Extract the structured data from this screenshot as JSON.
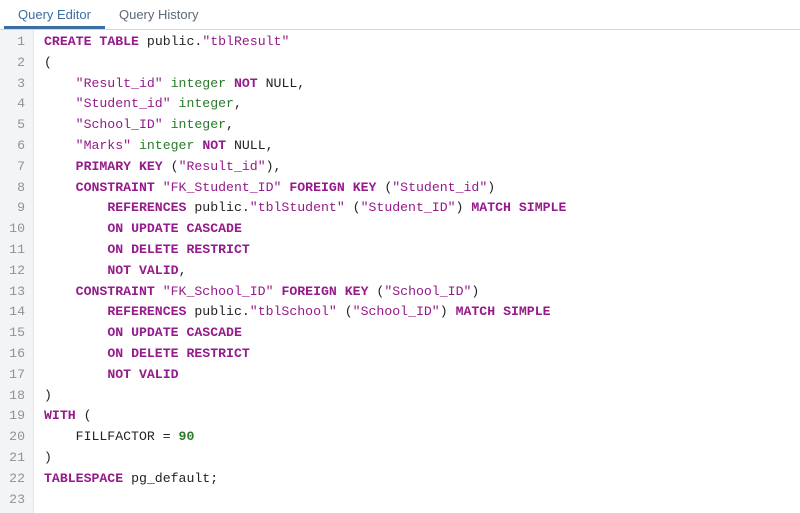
{
  "tabs": {
    "editor": "Query Editor",
    "history": "Query History",
    "active": "editor"
  },
  "code_lines": [
    [
      [
        "kw",
        "CREATE"
      ],
      [
        "pn",
        " "
      ],
      [
        "kw",
        "TABLE"
      ],
      [
        "pn",
        " "
      ],
      [
        "id",
        "public"
      ],
      [
        "pn",
        "."
      ],
      [
        "str",
        "\"tblResult\""
      ]
    ],
    [
      [
        "pn",
        "("
      ]
    ],
    [
      [
        "pn",
        "    "
      ],
      [
        "str",
        "\"Result_id\""
      ],
      [
        "pn",
        " "
      ],
      [
        "dt",
        "integer"
      ],
      [
        "pn",
        " "
      ],
      [
        "kw",
        "NOT"
      ],
      [
        "pn",
        " "
      ],
      [
        "null",
        "NULL"
      ],
      [
        "pn",
        ","
      ]
    ],
    [
      [
        "pn",
        "    "
      ],
      [
        "str",
        "\"Student_id\""
      ],
      [
        "pn",
        " "
      ],
      [
        "dt",
        "integer"
      ],
      [
        "pn",
        ","
      ]
    ],
    [
      [
        "pn",
        "    "
      ],
      [
        "str",
        "\"School_ID\""
      ],
      [
        "pn",
        " "
      ],
      [
        "dt",
        "integer"
      ],
      [
        "pn",
        ","
      ]
    ],
    [
      [
        "pn",
        "    "
      ],
      [
        "str",
        "\"Marks\""
      ],
      [
        "pn",
        " "
      ],
      [
        "dt",
        "integer"
      ],
      [
        "pn",
        " "
      ],
      [
        "kw",
        "NOT"
      ],
      [
        "pn",
        " "
      ],
      [
        "null",
        "NULL"
      ],
      [
        "pn",
        ","
      ]
    ],
    [
      [
        "pn",
        "    "
      ],
      [
        "kw",
        "PRIMARY"
      ],
      [
        "pn",
        " "
      ],
      [
        "kw",
        "KEY"
      ],
      [
        "pn",
        " ("
      ],
      [
        "str",
        "\"Result_id\""
      ],
      [
        "pn",
        "),"
      ]
    ],
    [
      [
        "pn",
        "    "
      ],
      [
        "kw",
        "CONSTRAINT"
      ],
      [
        "pn",
        " "
      ],
      [
        "str",
        "\"FK_Student_ID\""
      ],
      [
        "pn",
        " "
      ],
      [
        "kw",
        "FOREIGN"
      ],
      [
        "pn",
        " "
      ],
      [
        "kw",
        "KEY"
      ],
      [
        "pn",
        " ("
      ],
      [
        "str",
        "\"Student_id\""
      ],
      [
        "pn",
        ")"
      ]
    ],
    [
      [
        "pn",
        "        "
      ],
      [
        "kw",
        "REFERENCES"
      ],
      [
        "pn",
        " "
      ],
      [
        "id",
        "public"
      ],
      [
        "pn",
        "."
      ],
      [
        "str",
        "\"tblStudent\""
      ],
      [
        "pn",
        " ("
      ],
      [
        "str",
        "\"Student_ID\""
      ],
      [
        "pn",
        ") "
      ],
      [
        "kw",
        "MATCH"
      ],
      [
        "pn",
        " "
      ],
      [
        "kw2",
        "SIMPLE"
      ]
    ],
    [
      [
        "pn",
        "        "
      ],
      [
        "kw",
        "ON"
      ],
      [
        "pn",
        " "
      ],
      [
        "kw2",
        "UPDATE"
      ],
      [
        "pn",
        " "
      ],
      [
        "kw2",
        "CASCADE"
      ]
    ],
    [
      [
        "pn",
        "        "
      ],
      [
        "kw",
        "ON"
      ],
      [
        "pn",
        " "
      ],
      [
        "kw2",
        "DELETE"
      ],
      [
        "pn",
        " "
      ],
      [
        "kw2",
        "RESTRICT"
      ]
    ],
    [
      [
        "pn",
        "        "
      ],
      [
        "kw",
        "NOT"
      ],
      [
        "pn",
        " "
      ],
      [
        "kw2",
        "VALID"
      ],
      [
        "pn",
        ","
      ]
    ],
    [
      [
        "pn",
        "    "
      ],
      [
        "kw",
        "CONSTRAINT"
      ],
      [
        "pn",
        " "
      ],
      [
        "str",
        "\"FK_School_ID\""
      ],
      [
        "pn",
        " "
      ],
      [
        "kw",
        "FOREIGN"
      ],
      [
        "pn",
        " "
      ],
      [
        "kw",
        "KEY"
      ],
      [
        "pn",
        " ("
      ],
      [
        "str",
        "\"School_ID\""
      ],
      [
        "pn",
        ")"
      ]
    ],
    [
      [
        "pn",
        "        "
      ],
      [
        "kw",
        "REFERENCES"
      ],
      [
        "pn",
        " "
      ],
      [
        "id",
        "public"
      ],
      [
        "pn",
        "."
      ],
      [
        "str",
        "\"tblSchool\""
      ],
      [
        "pn",
        " ("
      ],
      [
        "str",
        "\"School_ID\""
      ],
      [
        "pn",
        ") "
      ],
      [
        "kw",
        "MATCH"
      ],
      [
        "pn",
        " "
      ],
      [
        "kw2",
        "SIMPLE"
      ]
    ],
    [
      [
        "pn",
        "        "
      ],
      [
        "kw",
        "ON"
      ],
      [
        "pn",
        " "
      ],
      [
        "kw2",
        "UPDATE"
      ],
      [
        "pn",
        " "
      ],
      [
        "kw2",
        "CASCADE"
      ]
    ],
    [
      [
        "pn",
        "        "
      ],
      [
        "kw",
        "ON"
      ],
      [
        "pn",
        " "
      ],
      [
        "kw2",
        "DELETE"
      ],
      [
        "pn",
        " "
      ],
      [
        "kw2",
        "RESTRICT"
      ]
    ],
    [
      [
        "pn",
        "        "
      ],
      [
        "kw",
        "NOT"
      ],
      [
        "pn",
        " "
      ],
      [
        "kw2",
        "VALID"
      ]
    ],
    [
      [
        "pn",
        ")"
      ]
    ],
    [
      [
        "kw",
        "WITH"
      ],
      [
        "pn",
        " ("
      ]
    ],
    [
      [
        "pn",
        "    "
      ],
      [
        "id",
        "FILLFACTOR"
      ],
      [
        "pn",
        " = "
      ],
      [
        "num",
        "90"
      ]
    ],
    [
      [
        "pn",
        ")"
      ]
    ],
    [
      [
        "kw",
        "TABLESPACE"
      ],
      [
        "pn",
        " "
      ],
      [
        "id",
        "pg_default"
      ],
      [
        "pn",
        ";"
      ]
    ],
    []
  ]
}
